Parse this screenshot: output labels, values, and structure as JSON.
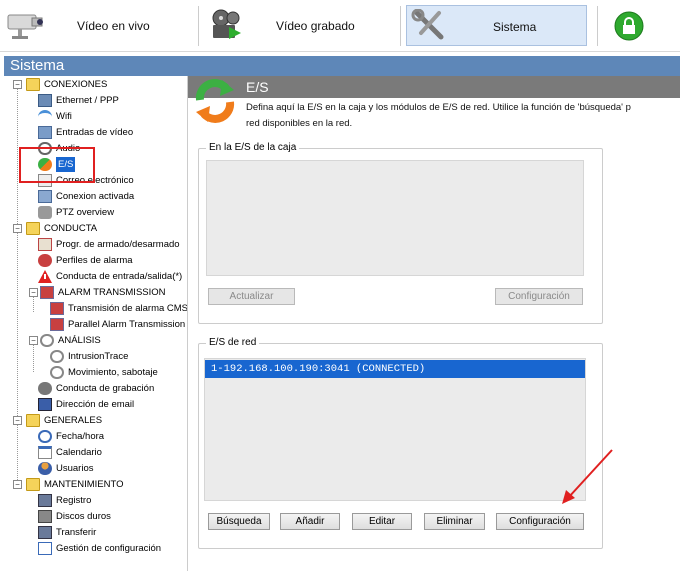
{
  "topbar": {
    "live_label": "Vídeo en vivo",
    "recorded_label": "Vídeo grabado",
    "system_label": "Sistema"
  },
  "section_title": "Sistema",
  "tree": [
    {
      "label": "CONEXIONES",
      "icon": "folder-icon"
    },
    {
      "label": "Ethernet / PPP",
      "icon": "network-icon"
    },
    {
      "label": "Wifi",
      "icon": "wifi-icon"
    },
    {
      "label": "Entradas de vídeo",
      "icon": "video-input-icon"
    },
    {
      "label": "Audio",
      "icon": "audio-icon"
    },
    {
      "label": "E/S",
      "icon": "io-icon",
      "selected": true
    },
    {
      "label": "Correo electrónico",
      "icon": "email-icon"
    },
    {
      "label": "Conexion activada",
      "icon": "connection-icon"
    },
    {
      "label": "PTZ overview",
      "icon": "ptz-icon"
    },
    {
      "label": "CONDUCTA",
      "icon": "folder-icon"
    },
    {
      "label": "Progr. de armado/desarmado",
      "icon": "schedule-icon"
    },
    {
      "label": "Perfiles de alarma",
      "icon": "alarm-profile-icon"
    },
    {
      "label": "Conducta de entrada/salida(*)",
      "icon": "warning-icon"
    },
    {
      "label": "ALARM TRANSMISSION",
      "icon": "alarm-transmission-icon"
    },
    {
      "label": "Transmisión de alarma CMS",
      "icon": "cms-icon"
    },
    {
      "label": "Parallel Alarm Transmission",
      "icon": "parallel-icon"
    },
    {
      "label": "ANÁLISIS",
      "icon": "analysis-icon"
    },
    {
      "label": "IntrusionTrace",
      "icon": "intrusion-icon"
    },
    {
      "label": "Movimiento, sabotaje",
      "icon": "motion-icon"
    },
    {
      "label": "Conducta de grabación",
      "icon": "recording-icon"
    },
    {
      "label": "Dirección de email",
      "icon": "email-address-icon"
    },
    {
      "label": "GENERALES",
      "icon": "folder-icon"
    },
    {
      "label": "Fecha/hora",
      "icon": "clock-icon"
    },
    {
      "label": "Calendario",
      "icon": "calendar-icon"
    },
    {
      "label": "Usuarios",
      "icon": "users-icon"
    },
    {
      "label": "MANTENIMIENTO",
      "icon": "folder-icon"
    },
    {
      "label": "Registro",
      "icon": "log-icon"
    },
    {
      "label": "Discos duros",
      "icon": "disk-icon"
    },
    {
      "label": "Transferir",
      "icon": "transfer-icon"
    },
    {
      "label": "Gestión de configuración",
      "icon": "config-icon"
    }
  ],
  "panel": {
    "title": "E/S",
    "description_line1": "Defina aquí la E/S en la caja y los módulos de E/S de red. Utilice la función de 'búsqueda' p",
    "description_line2": "red disponibles en la red."
  },
  "box_io": {
    "label": "En la E/S de la caja",
    "update_button": "Actualizar",
    "config_button": "Configuración"
  },
  "net_io": {
    "label": "E/S de red",
    "entries": [
      "1-192.168.100.190:3041 (CONNECTED)"
    ],
    "search_button": "Búsqueda",
    "add_button": "Añadir",
    "edit_button": "Editar",
    "delete_button": "Eliminar",
    "config_button": "Configuración"
  }
}
